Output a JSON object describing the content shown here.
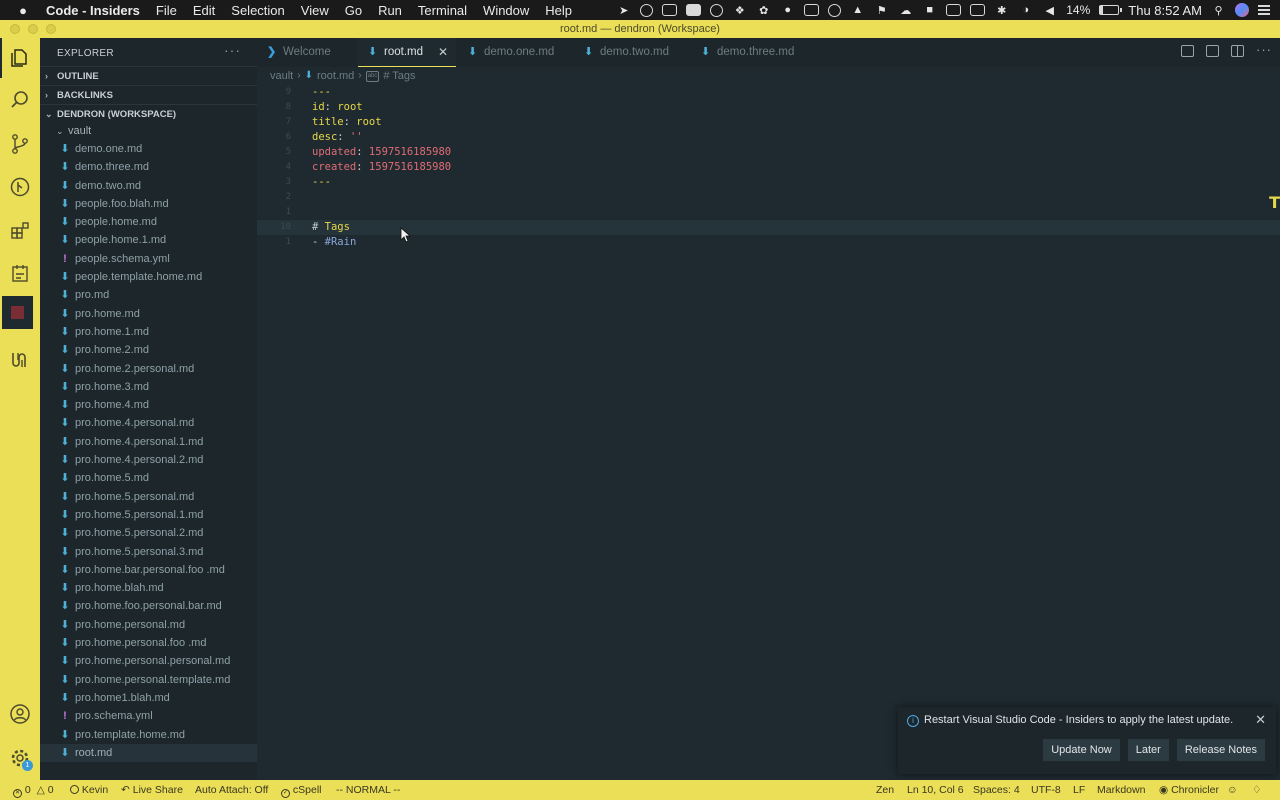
{
  "menubar": {
    "app_name": "Code - Insiders",
    "menus": [
      "File",
      "Edit",
      "Selection",
      "View",
      "Go",
      "Run",
      "Terminal",
      "Window",
      "Help"
    ],
    "battery_pct": "14%",
    "battery_level": 0.14,
    "clock": "Thu 8:52 AM"
  },
  "window": {
    "title": "root.md — dendron (Workspace)"
  },
  "sidebar": {
    "title": "EXPLORER",
    "sections": {
      "outline": "OUTLINE",
      "backlinks": "BACKLINKS",
      "workspace": "DENDRON (WORKSPACE)"
    },
    "folder": "vault",
    "files": [
      {
        "name": "demo.one.md",
        "type": "md"
      },
      {
        "name": "demo.three.md",
        "type": "md"
      },
      {
        "name": "demo.two.md",
        "type": "md"
      },
      {
        "name": "people.foo.blah.md",
        "type": "md"
      },
      {
        "name": "people.home.md",
        "type": "md"
      },
      {
        "name": "people.home.1.md",
        "type": "md"
      },
      {
        "name": "people.schema.yml",
        "type": "yml"
      },
      {
        "name": "people.template.home.md",
        "type": "md"
      },
      {
        "name": "pro.md",
        "type": "md"
      },
      {
        "name": "pro.home.md",
        "type": "md"
      },
      {
        "name": "pro.home.1.md",
        "type": "md"
      },
      {
        "name": "pro.home.2.md",
        "type": "md"
      },
      {
        "name": "pro.home.2.personal.md",
        "type": "md"
      },
      {
        "name": "pro.home.3.md",
        "type": "md"
      },
      {
        "name": "pro.home.4.md",
        "type": "md"
      },
      {
        "name": "pro.home.4.personal.md",
        "type": "md"
      },
      {
        "name": "pro.home.4.personal.1.md",
        "type": "md"
      },
      {
        "name": "pro.home.4.personal.2.md",
        "type": "md"
      },
      {
        "name": "pro.home.5.md",
        "type": "md"
      },
      {
        "name": "pro.home.5.personal.md",
        "type": "md"
      },
      {
        "name": "pro.home.5.personal.1.md",
        "type": "md"
      },
      {
        "name": "pro.home.5.personal.2.md",
        "type": "md"
      },
      {
        "name": "pro.home.5.personal.3.md",
        "type": "md"
      },
      {
        "name": "pro.home.bar.personal.foo .md",
        "type": "md"
      },
      {
        "name": "pro.home.blah.md",
        "type": "md"
      },
      {
        "name": "pro.home.foo.personal.bar.md",
        "type": "md"
      },
      {
        "name": "pro.home.personal.md",
        "type": "md"
      },
      {
        "name": "pro.home.personal.foo .md",
        "type": "md"
      },
      {
        "name": "pro.home.personal.personal.md",
        "type": "md"
      },
      {
        "name": "pro.home.personal.template.md",
        "type": "md"
      },
      {
        "name": "pro.home1.blah.md",
        "type": "md"
      },
      {
        "name": "pro.schema.yml",
        "type": "yml"
      },
      {
        "name": "pro.template.home.md",
        "type": "md"
      },
      {
        "name": "root.md",
        "type": "md",
        "selected": true
      }
    ]
  },
  "tabs": [
    {
      "label": "Welcome",
      "icon": "vscode-logo-icon"
    },
    {
      "label": "root.md",
      "icon": "markdown-icon",
      "active": true
    },
    {
      "label": "demo.one.md",
      "icon": "markdown-icon"
    },
    {
      "label": "demo.two.md",
      "icon": "markdown-icon"
    },
    {
      "label": "demo.three.md",
      "icon": "markdown-icon"
    }
  ],
  "breadcrumb": {
    "folder": "vault",
    "file": "root.md",
    "symbol": "# Tags"
  },
  "editor": {
    "lines": [
      {
        "num": "9",
        "segments": [
          [
            "dash",
            "---"
          ]
        ]
      },
      {
        "num": "8",
        "segments": [
          [
            "k",
            "id"
          ],
          [
            "v",
            ": "
          ],
          [
            "k",
            "root"
          ]
        ]
      },
      {
        "num": "7",
        "segments": [
          [
            "k",
            "title"
          ],
          [
            "v",
            ": "
          ],
          [
            "k",
            "root"
          ]
        ]
      },
      {
        "num": "6",
        "segments": [
          [
            "k",
            "desc"
          ],
          [
            "v",
            ": "
          ],
          [
            "s",
            "''"
          ]
        ]
      },
      {
        "num": "5",
        "segments": [
          [
            "n",
            "updated"
          ],
          [
            "v",
            ": "
          ],
          [
            "n",
            "1597516185980"
          ]
        ]
      },
      {
        "num": "4",
        "segments": [
          [
            "n",
            "created"
          ],
          [
            "v",
            ": "
          ],
          [
            "n",
            "1597516185980"
          ]
        ]
      },
      {
        "num": "3",
        "segments": [
          [
            "dash",
            "---"
          ]
        ]
      },
      {
        "num": "2",
        "segments": []
      },
      {
        "num": "1",
        "segments": []
      },
      {
        "num": "10",
        "segments": [
          [
            "v",
            "# "
          ],
          [
            "hd",
            "Tags"
          ]
        ],
        "current": true
      },
      {
        "num": "1",
        "segments": [
          [
            "v",
            "- "
          ],
          [
            "tag",
            "#Rain"
          ]
        ]
      }
    ]
  },
  "notification": {
    "message": "Restart Visual Studio Code - Insiders to apply the latest update.",
    "buttons": [
      "Update Now",
      "Later",
      "Release Notes"
    ]
  },
  "statusbar": {
    "errors": "0",
    "warnings": "0",
    "user": "Kevin",
    "live_share": "Live Share",
    "auto_attach": "Auto Attach: Off",
    "cspell": "cSpell",
    "vim_mode": "-- NORMAL --",
    "zen": "Zen",
    "position": "Ln 10, Col 6",
    "spaces": "Spaces: 4",
    "encoding": "UTF-8",
    "eol": "LF",
    "language": "Markdown",
    "chronicler": "Chronicler"
  },
  "colors": {
    "accent": "#eadf57",
    "editor_bg": "#1e2a30",
    "sidebar_bg": "#1c262b"
  }
}
